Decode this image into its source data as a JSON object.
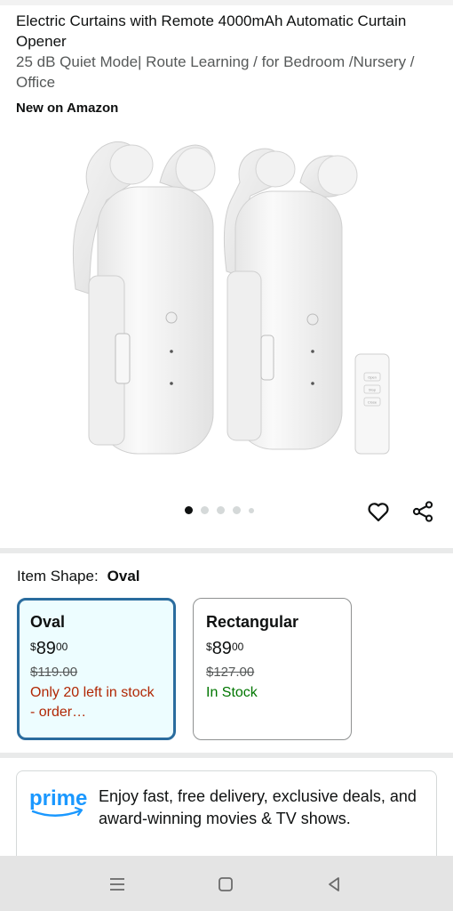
{
  "product": {
    "title": "Electric Curtains with Remote 4000mAh Automatic Curtain Opener",
    "subtitle": "25 dB Quiet Mode| Route Learning / for Bedroom /Nursery / Office",
    "badge": "New on Amazon",
    "remote_buttons": [
      "Open",
      "Stop",
      "Close"
    ]
  },
  "gallery": {
    "dot_count": 5,
    "active_index": 0
  },
  "actions": {
    "favorite_icon": "heart-icon",
    "share_icon": "share-icon"
  },
  "item_shape": {
    "label": "Item Shape:",
    "selected": "Oval",
    "options": [
      {
        "name": "Oval",
        "currency": "$",
        "price_whole": "89",
        "price_fraction": "00",
        "list_price": "$119.00",
        "stock": "Only 20 left in stock - order…",
        "stock_color": "#b12704",
        "selected": true
      },
      {
        "name": "Rectangular",
        "currency": "$",
        "price_whole": "89",
        "price_fraction": "00",
        "list_price": "$127.00",
        "stock": "In Stock",
        "stock_color": "#007600",
        "selected": false
      }
    ]
  },
  "prime": {
    "logo_text": "prime",
    "message": "Enjoy fast, free delivery, exclusive deals, and award-winning movies & TV shows.",
    "brand_color": "#1a98ff"
  },
  "system_nav": {
    "menu_icon": "recent-apps-icon",
    "home_icon": "home-icon",
    "back_icon": "back-icon"
  },
  "colors": {
    "selected_border": "#2a6c9e",
    "selected_bg": "#edfdff"
  }
}
